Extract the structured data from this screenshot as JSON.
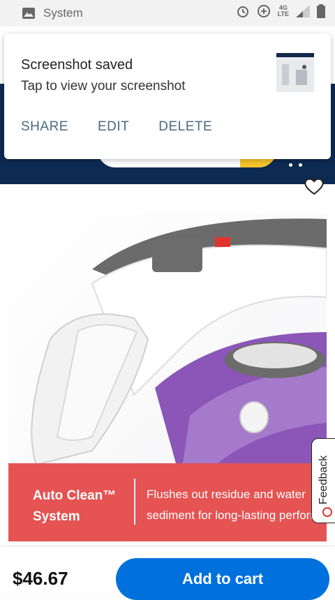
{
  "status_bar": {
    "label": "System",
    "network": "4G",
    "network_sub": "LTE",
    "icons": [
      "image-icon",
      "alarm-icon",
      "data-saver-icon",
      "signal-icon",
      "battery-icon"
    ]
  },
  "notification": {
    "title": "Screenshot saved",
    "subtitle": "Tap to view your screenshot",
    "actions": [
      "SHARE",
      "EDIT",
      "DELETE"
    ]
  },
  "header": {
    "background": "#0d2a52",
    "accent": "#f7c52b"
  },
  "product": {
    "banner": {
      "left_line1": "Auto Clean™",
      "left_line2": "System",
      "right_line1": "Flushes out residue and water",
      "right_line2": "sediment for long-lasting performan"
    },
    "feedback_label": "Feedback"
  },
  "purchase": {
    "price": "$46.67",
    "cta": "Add to cart",
    "cta_color": "#0071dc"
  }
}
